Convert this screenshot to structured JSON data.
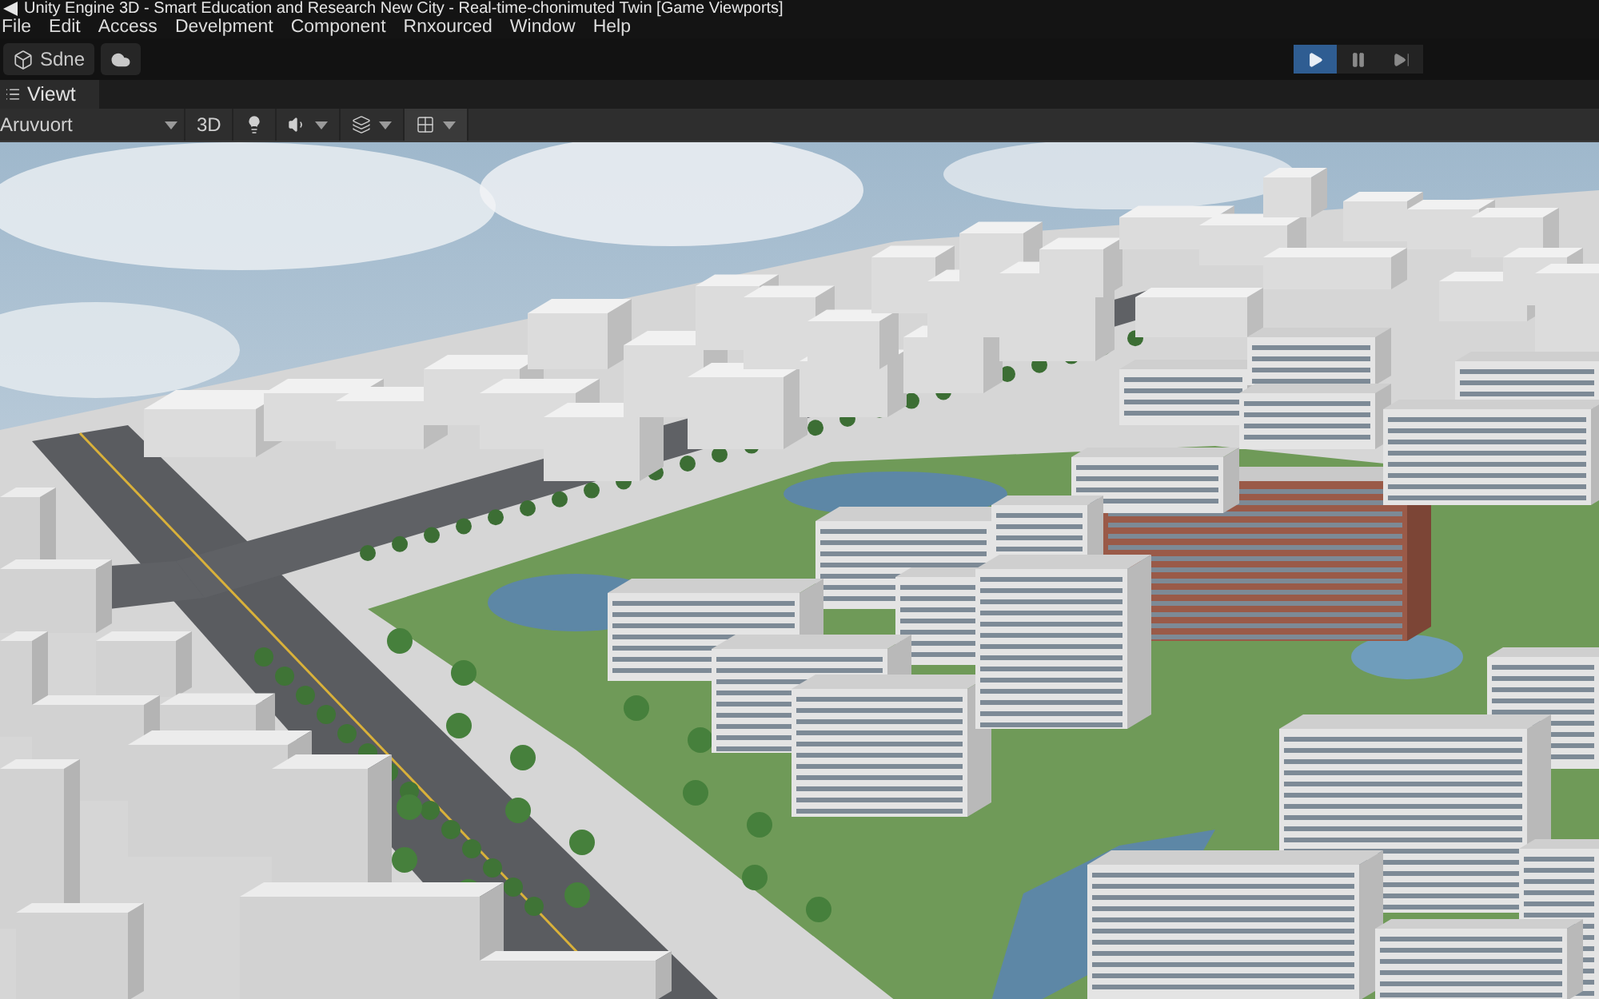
{
  "window": {
    "title": "Unity Engine 3D - Smart Education and Research New City - Real-time-chonimuted Twin [Game Viewports]"
  },
  "menu_bar": [
    "File",
    "Edit",
    "Access",
    "Develpment",
    "Component",
    "Rnxourced",
    "Window",
    "Help"
  ],
  "toolbar": {
    "scene_button": "Sdne",
    "play_controls": [
      {
        "kind": "play",
        "selected": true
      },
      {
        "kind": "pause",
        "selected": false
      },
      {
        "kind": "step",
        "selected": false
      }
    ]
  },
  "tabs": [
    {
      "label": "Viewt",
      "selected": true
    }
  ],
  "view_toolbar": {
    "camera_dropdown": "Aruvuort",
    "mode_button": "3D"
  }
}
